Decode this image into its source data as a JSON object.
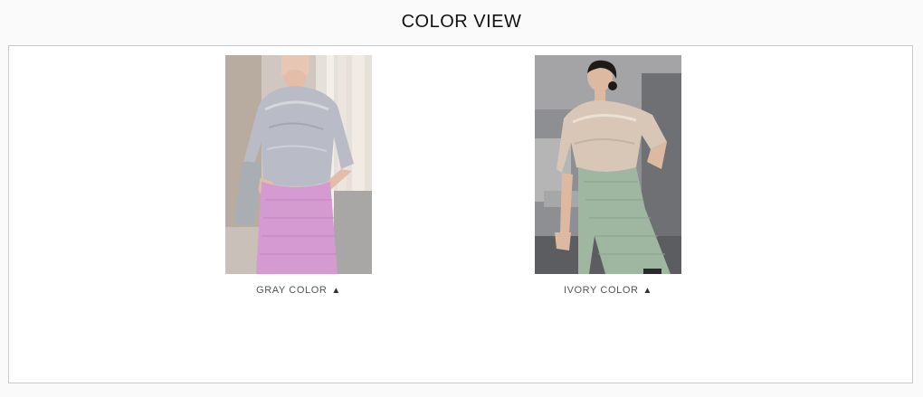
{
  "section": {
    "title": "COLOR VIEW"
  },
  "colors": [
    {
      "label": "GRAY COLOR",
      "arrow_icon": "triangle-up-icon",
      "photo_alt": "gray-color-photo"
    },
    {
      "label": "IVORY COLOR",
      "arrow_icon": "triangle-up-icon",
      "photo_alt": "ivory-color-photo"
    }
  ],
  "palette": {
    "background": "#fafafa",
    "frame_border": "#c9c9c9",
    "gray_top": "#b9bcc6",
    "gray_skirt": "#d49bd0",
    "ivory_top": "#d8c7b6",
    "ivory_skirt": "#9fb6a1"
  }
}
